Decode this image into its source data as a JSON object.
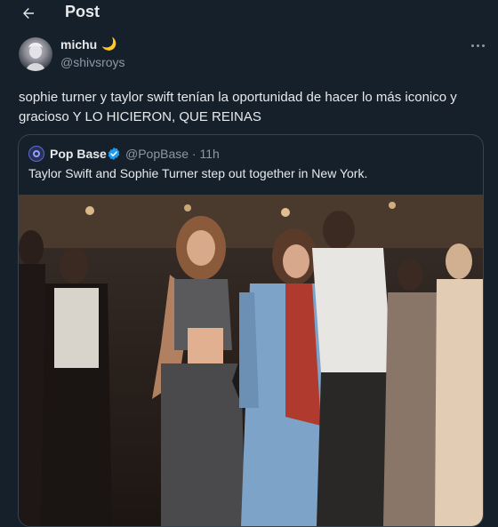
{
  "header": {
    "back_icon": "arrow-left-icon",
    "title": "Post"
  },
  "post": {
    "user": {
      "name": "michu",
      "emoji": "🌙",
      "handle": "@shivsroys"
    },
    "text": "sophie turner y taylor swift tenían la oportunidad de hacer lo más iconico y gracioso Y LO HICIERON, QUE REINAS",
    "more_icon": "more-horizontal-icon"
  },
  "quoted": {
    "name": "Pop Base",
    "handle_time": "@PopBase · 11h",
    "verified_icon": "verified-badge-icon",
    "text": "Taylor Swift and Sophie Turner step out together in New York."
  },
  "colors": {
    "background": "#15202b",
    "text": "#e7e9ea",
    "muted": "#8b98a5",
    "border": "#38444d",
    "verified": "#1d9bf0"
  }
}
